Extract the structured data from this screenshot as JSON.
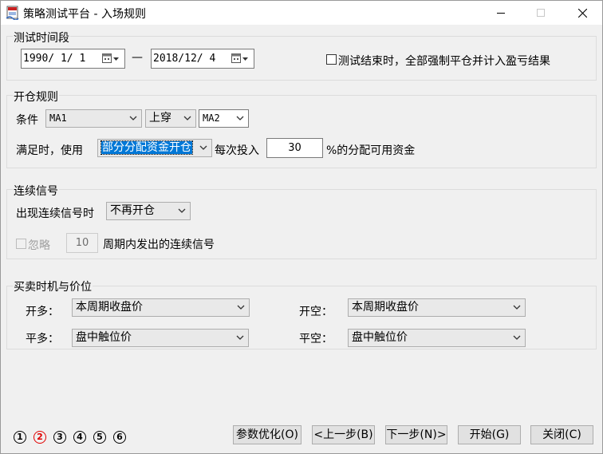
{
  "window": {
    "title": "策略测试平台 - 入场规则"
  },
  "time_period": {
    "group_label": "测试时间段",
    "start_date": "1990/ 1/ 1",
    "separator": "—",
    "end_date": "2018/12/ 4",
    "force_close_label": "测试结束时，全部强制平仓并计入盈亏结果",
    "force_close_checked": false
  },
  "open_rule": {
    "group_label": "开仓规则",
    "condition_label": "条件",
    "left_indicator": "MA1",
    "operator": "上穿",
    "right_indicator": "MA2",
    "when_label": "满足时，使用",
    "mode": "部分分配资金开仓",
    "each_input_label": "每次投入",
    "percent_value": "30",
    "percent_suffix": "%的分配可用资金"
  },
  "continuous_signal": {
    "group_label": "连续信号",
    "on_signal_label": "出现连续信号时",
    "action": "不再开仓",
    "ignore_label": "忽略",
    "ignore_checked": false,
    "period_value": "10",
    "period_suffix": "周期内发出的连续信号"
  },
  "timing": {
    "group_label": "买卖时机与价位",
    "open_long_label": "开多：",
    "open_long_value": "本周期收盘价",
    "open_short_label": "开空：",
    "open_short_value": "本周期收盘价",
    "close_long_label": "平多：",
    "close_long_value": "盘中触位价",
    "close_short_label": "平空：",
    "close_short_value": "盘中触位价"
  },
  "steps": {
    "items": [
      "1",
      "2",
      "3",
      "4",
      "5",
      "6"
    ],
    "current": 2,
    "active_color": "#e00000"
  },
  "buttons": {
    "optimize": "参数优化(O)",
    "prev": "<上一步(B)",
    "next": "下一步(N)>",
    "start": "开始(G)",
    "close": "关闭(C)"
  }
}
